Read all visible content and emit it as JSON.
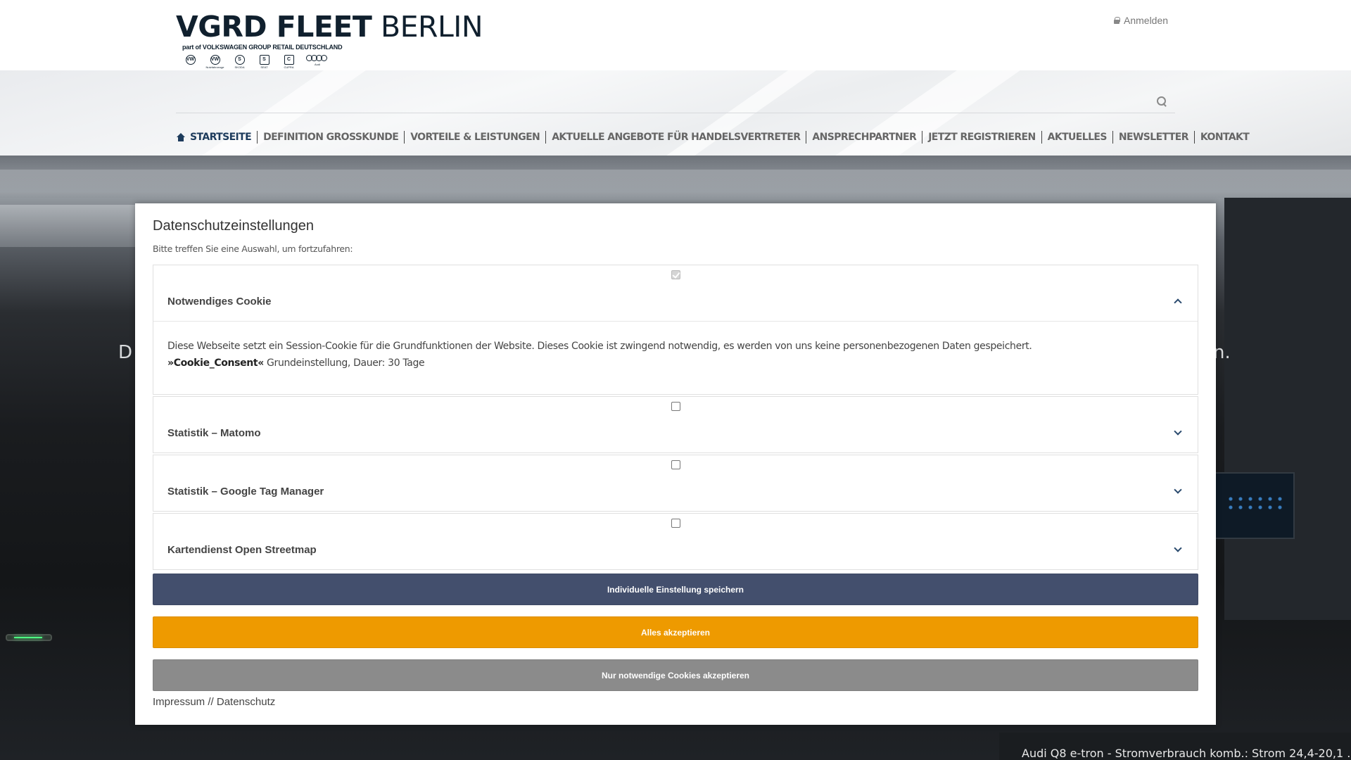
{
  "logo": {
    "title_bold": "VGRD FLEET",
    "title_light": "BERLIN",
    "subtitle": "part of VOLKSWAGEN GROUP RETAIL DEUTSCHLAND",
    "brands": [
      {
        "name": "",
        "mark": "VW"
      },
      {
        "name": "Nutzfahrzeuge",
        "mark": "VW"
      },
      {
        "name": "SKODA",
        "mark": "S"
      },
      {
        "name": "SEAT",
        "mark": "S"
      },
      {
        "name": "CUPRA",
        "mark": "C"
      },
      {
        "name": "Audi",
        "mark": ""
      }
    ]
  },
  "header": {
    "login_label": "Anmelden"
  },
  "nav": {
    "items": [
      "STARTSEITE",
      "DEFINITION GROSSKUNDE",
      "VORTEILE & LEISTUNGEN",
      "AKTUELLE ANGEBOTE FÜR HANDELSVERTRETER",
      "ANSPRECHPARTNER",
      "JETZT REGISTRIEREN",
      "AKTUELLES",
      "NEWSLETTER",
      "KONTAKT"
    ]
  },
  "hero": {
    "text_left": "D",
    "text_right": "n.",
    "caption": "Audi Q8 e-tron - Stromverbrauch komb.: Strom 24,4-20,1 ..."
  },
  "modal": {
    "title": "Datenschutzeinstellungen",
    "subtitle": "Bitte treffen Sie eine Auswahl, um fortzufahren:",
    "cookies": [
      {
        "label": "Notwendiges Cookie",
        "checked": true,
        "expanded": true,
        "description": "Diese Webseite setzt ein Session-Cookie für die Grundfunktionen der Website. Dieses Cookie ist zwingend notwendig, es werden von uns keine personenbezogenen Daten gespeichert.",
        "cookie_name": "»Cookie_Consent«",
        "cookie_detail": " Grundeinstellung, Dauer: 30 Tage"
      },
      {
        "label": "Statistik – Matomo",
        "checked": false,
        "expanded": false
      },
      {
        "label": "Statistik – Google Tag Manager",
        "checked": false,
        "expanded": false
      },
      {
        "label": "Kartendienst Open Streetmap",
        "checked": false,
        "expanded": false
      }
    ],
    "buttons": {
      "save": "Individuelle Einstellung speichern",
      "accept_all": "Alles akzeptieren",
      "necessary_only": "Nur notwendige Cookies akzeptieren"
    },
    "footer": {
      "impressum": "Impressum",
      "separator": " // ",
      "datenschutz": "Datenschutz"
    }
  },
  "colors": {
    "brand_dark": "#10202e",
    "nav_active": "#1d3b5c",
    "btn_save": "#434f6d",
    "btn_accept": "#ee9a00",
    "btn_necessary": "#8b8b8b"
  }
}
